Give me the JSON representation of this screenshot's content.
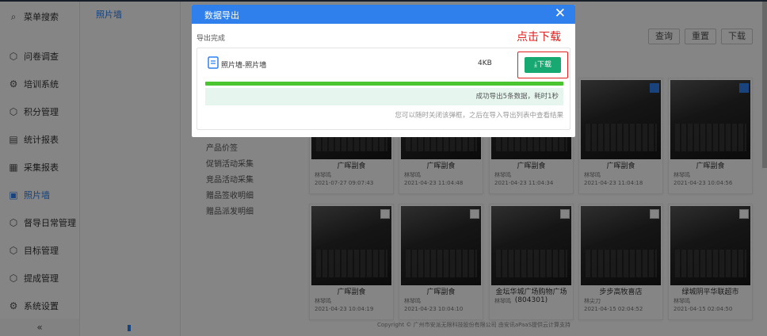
{
  "sidebar": {
    "items": [
      {
        "label": "菜单搜索",
        "icon": "search-icon"
      },
      {
        "label": "问卷调查",
        "icon": "hexagon-icon"
      },
      {
        "label": "培训系统",
        "icon": "gear-icon"
      },
      {
        "label": "积分管理",
        "icon": "hexagon-icon"
      },
      {
        "label": "统计报表",
        "icon": "report-icon"
      },
      {
        "label": "采集报表",
        "icon": "table-icon"
      },
      {
        "label": "照片墙",
        "icon": "photo-icon"
      },
      {
        "label": "督导日常管理",
        "icon": "hexagon-icon"
      },
      {
        "label": "目标管理",
        "icon": "hexagon-icon"
      },
      {
        "label": "提成管理",
        "icon": "hexagon-icon"
      },
      {
        "label": "系统设置",
        "icon": "gear-icon"
      }
    ],
    "collapse_label": "«",
    "active_index": 6
  },
  "subnav": {
    "tab": "照片墙",
    "list": [
      "产品价签",
      "促销活动采集",
      "竞品活动采集",
      "赠品签收明细",
      "赠品派发明细"
    ]
  },
  "toolbar": {
    "query": "查询",
    "reset": "重置",
    "download": "下载"
  },
  "cards": [
    {
      "title": "广晖副食",
      "person": "林琴鸣",
      "time": "2021-07-27 09:07:43",
      "checked": false
    },
    {
      "title": "广晖副食",
      "person": "林琴鸣",
      "time": "2021-04-23 11:04:48",
      "checked": false
    },
    {
      "title": "广晖副食",
      "person": "林琴鸣",
      "time": "2021-04-23 11:04:34",
      "checked": false
    },
    {
      "title": "广晖副食",
      "person": "林琴鸣",
      "time": "2021-04-23 11:04:18",
      "checked": true
    },
    {
      "title": "广晖副食",
      "person": "林琴鸣",
      "time": "2021-04-23 10:04:56",
      "checked": true
    },
    {
      "title": "广晖副食",
      "person": "林琴鸣",
      "time": "2021-04-23 10:04:19",
      "checked": false
    },
    {
      "title": "广晖副食",
      "person": "林琴鸣",
      "time": "2021-04-23 10:04:10",
      "checked": false
    },
    {
      "title": "金坛华城广场购物广场\n(804301)",
      "person": "林琴鸣",
      "time": "",
      "checked": false
    },
    {
      "title": "步步高牧喜店",
      "person": "林尖刀",
      "time": "2021-04-15 02:04:52",
      "checked": false
    },
    {
      "title": "绿城阴平华联超市",
      "person": "林琴鸣",
      "time": "2021-04-15 02:04:50",
      "checked": false
    }
  ],
  "modal": {
    "title": "数据导出",
    "close": "✕",
    "done_label": "导出完成",
    "hint": "点击下载",
    "file_name": "照片墙-照片墙",
    "file_size": "4KB",
    "download_label": "⤓下载",
    "progress": 1.0,
    "success_text": "成功导出5条数据，耗时1秒",
    "note": "您可以随时关闭该弹框，之后在导入导出列表中查看结果"
  },
  "footer": "Copyright © 广州市安派无限科技股份有限公司 由安讯aPaaS提供云计算支持",
  "colors": {
    "accent": "#2f80ed",
    "download": "#17a971",
    "hint": "#e02020",
    "progress": "#4bc52f"
  }
}
